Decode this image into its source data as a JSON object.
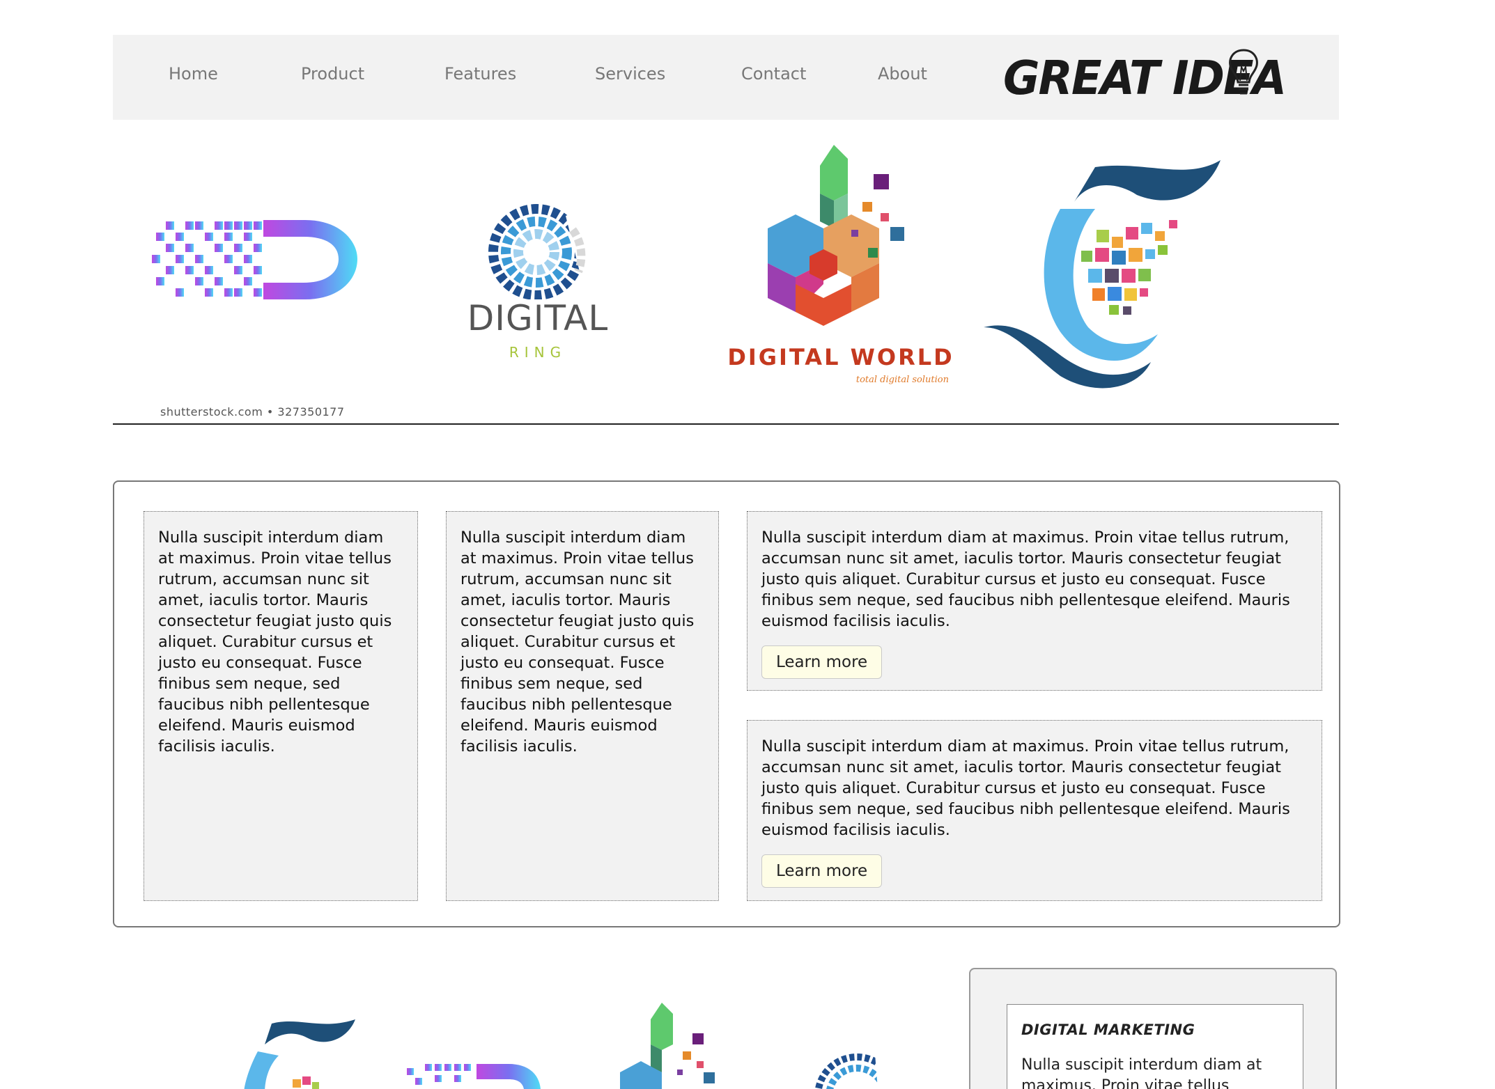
{
  "nav": {
    "items": [
      {
        "label": "Home"
      },
      {
        "label": "Product"
      },
      {
        "label": "Features"
      },
      {
        "label": "Services"
      },
      {
        "label": "Contact"
      },
      {
        "label": "About"
      }
    ],
    "brand": "GREAT IDEA"
  },
  "banner": {
    "logo2_text": "DIGITAL",
    "logo2_sub": "RING",
    "logo3_text": "DIGITAL WORLD",
    "logo3_tagline": "total digital solution",
    "caption": "shutterstock.com • 327350177"
  },
  "cards": [
    {
      "text": "Nulla suscipit interdum diam at maximus. Proin vitae tellus rutrum, accumsan nunc sit amet, iaculis tortor. Mauris consectetur feugiat justo quis aliquet. Curabitur cursus et justo eu consequat. Fusce finibus sem neque, sed faucibus nibh pellentesque eleifend. Mauris euismod facilisis iaculis."
    },
    {
      "text": "Nulla suscipit interdum diam at maximus. Proin vitae tellus rutrum, accumsan nunc sit amet, iaculis tortor. Mauris consectetur feugiat justo quis aliquet. Curabitur cursus et justo eu consequat. Fusce finibus sem neque, sed faucibus nibh pellentesque eleifend. Mauris euismod facilisis iaculis."
    },
    {
      "text": "Nulla suscipit interdum diam at maximus. Proin vitae tellus rutrum, accumsan nunc sit amet, iaculis tortor. Mauris consectetur feugiat justo quis aliquet. Curabitur cursus et justo eu consequat. Fusce finibus sem neque, sed faucibus nibh pellentesque eleifend. Mauris euismod facilisis iaculis.",
      "button": "Learn more"
    },
    {
      "text": "Nulla suscipit interdum diam at maximus. Proin vitae tellus rutrum, accumsan nunc sit amet, iaculis tortor. Mauris consectetur feugiat justo quis aliquet. Curabitur cursus et justo eu consequat. Fusce finibus sem neque, sed faucibus nibh pellentesque eleifend. Mauris euismod facilisis iaculis.",
      "button": "Learn more"
    }
  ],
  "sidebar": {
    "title": "DIGITAL MARKETING",
    "text": "Nulla suscipit interdum diam at maximus. Proin vitae tellus rutrum,"
  },
  "colors": {
    "nav_bg": "#f2f2f2",
    "card_bg": "#f2f2f2",
    "button_bg": "#fefde6",
    "nav_text": "#777777"
  }
}
